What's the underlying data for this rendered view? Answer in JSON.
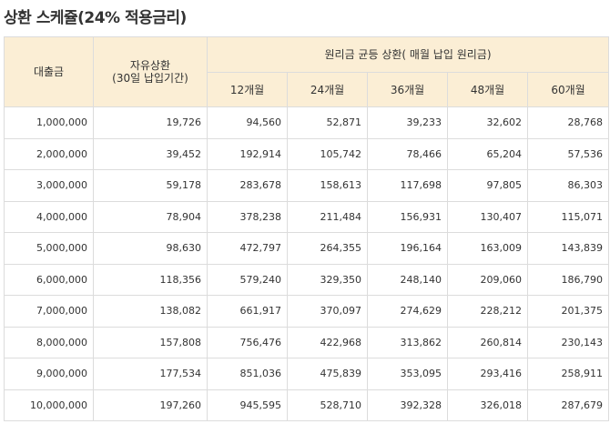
{
  "title": "상환 스케쥴(24% 적용금리)",
  "table": {
    "header": {
      "loan_amount": "대출금",
      "free_repayment_line1": "자유상환",
      "free_repayment_line2": "(30일 납입기간)",
      "equal_installment": "원리금 균등 상환( 매월 납입 원리금)",
      "periods": [
        "12개월",
        "24개월",
        "36개월",
        "48개월",
        "60개월"
      ]
    },
    "rows": [
      {
        "amount": "1,000,000",
        "free": "19,726",
        "m12": "94,560",
        "m24": "52,871",
        "m36": "39,233",
        "m48": "32,602",
        "m60": "28,768"
      },
      {
        "amount": "2,000,000",
        "free": "39,452",
        "m12": "192,914",
        "m24": "105,742",
        "m36": "78,466",
        "m48": "65,204",
        "m60": "57,536"
      },
      {
        "amount": "3,000,000",
        "free": "59,178",
        "m12": "283,678",
        "m24": "158,613",
        "m36": "117,698",
        "m48": "97,805",
        "m60": "86,303"
      },
      {
        "amount": "4,000,000",
        "free": "78,904",
        "m12": "378,238",
        "m24": "211,484",
        "m36": "156,931",
        "m48": "130,407",
        "m60": "115,071"
      },
      {
        "amount": "5,000,000",
        "free": "98,630",
        "m12": "472,797",
        "m24": "264,355",
        "m36": "196,164",
        "m48": "163,009",
        "m60": "143,839"
      },
      {
        "amount": "6,000,000",
        "free": "118,356",
        "m12": "579,240",
        "m24": "329,350",
        "m36": "248,140",
        "m48": "209,060",
        "m60": "186,790"
      },
      {
        "amount": "7,000,000",
        "free": "138,082",
        "m12": "661,917",
        "m24": "370,097",
        "m36": "274,629",
        "m48": "228,212",
        "m60": "201,375"
      },
      {
        "amount": "8,000,000",
        "free": "157,808",
        "m12": "756,476",
        "m24": "422,968",
        "m36": "313,862",
        "m48": "260,814",
        "m60": "230,143"
      },
      {
        "amount": "9,000,000",
        "free": "177,534",
        "m12": "851,036",
        "m24": "475,839",
        "m36": "353,095",
        "m48": "293,416",
        "m60": "258,911"
      },
      {
        "amount": "10,000,000",
        "free": "197,260",
        "m12": "945,595",
        "m24": "528,710",
        "m36": "392,328",
        "m48": "326,018",
        "m60": "287,679"
      }
    ]
  },
  "colors": {
    "header_bg": "#fbeed5",
    "border": "#dcdcdc",
    "text": "#333333"
  }
}
